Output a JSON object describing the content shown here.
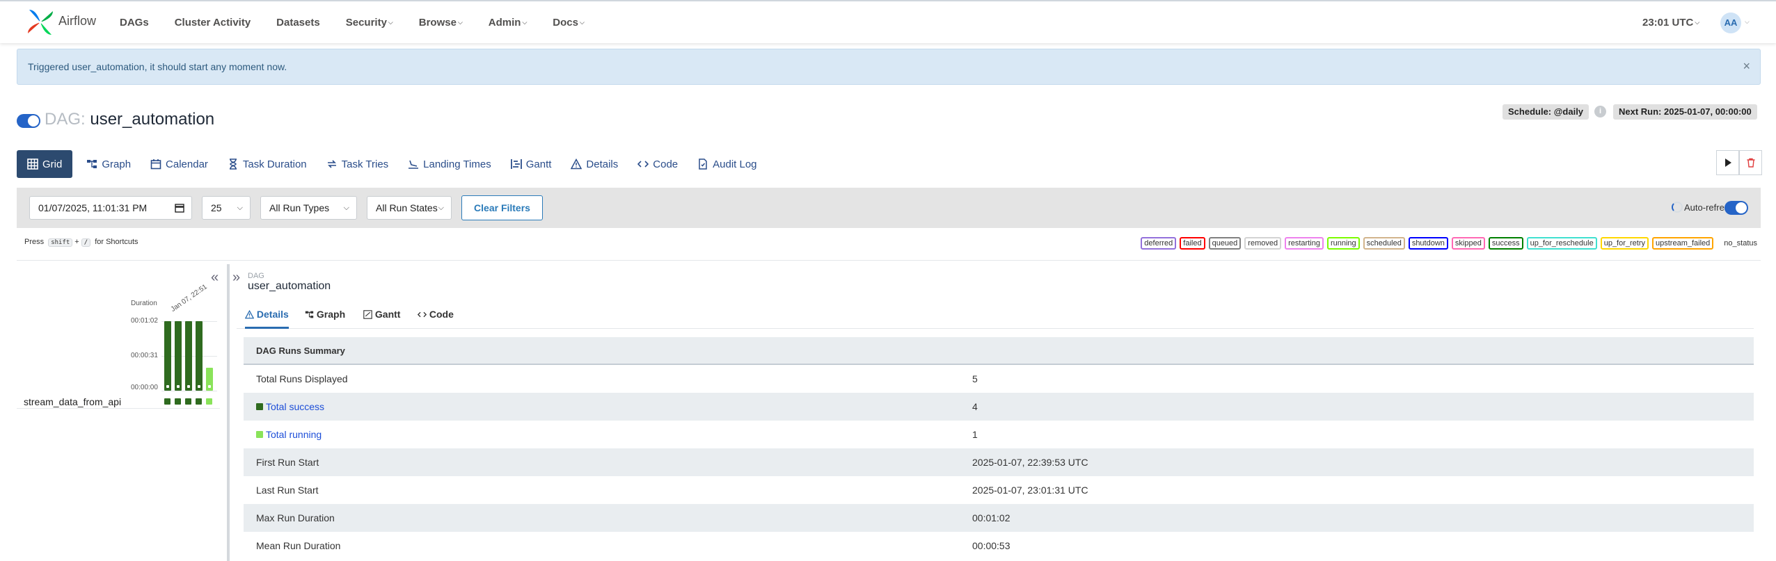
{
  "nav": {
    "brand": "Airflow",
    "links": [
      "DAGs",
      "Cluster Activity",
      "Datasets",
      "Security",
      "Browse",
      "Admin",
      "Docs"
    ],
    "time": "23:01 UTC",
    "avatar": "AA"
  },
  "alert": {
    "message": "Triggered user_automation, it should start any moment now.",
    "close": "×"
  },
  "dag": {
    "prefix": "DAG:",
    "name": "user_automation",
    "paused": false,
    "schedule": "Schedule: @daily",
    "next_run": "Next Run: 2025-01-07, 00:00:00"
  },
  "tabs": [
    "Grid",
    "Graph",
    "Calendar",
    "Task Duration",
    "Task Tries",
    "Landing Times",
    "Gantt",
    "Details",
    "Code",
    "Audit Log"
  ],
  "filters": {
    "date": "01/07/2025, 11:01:31 PM",
    "num_runs": "25",
    "run_type": "All Run Types",
    "run_state": "All Run States",
    "clear": "Clear Filters",
    "auto_refresh": "Auto-refresh"
  },
  "shortcuts": {
    "prefix": "Press",
    "key1": "shift",
    "plus": "+",
    "key2": "/",
    "suffix": "for Shortcuts"
  },
  "legend": [
    {
      "label": "deferred",
      "color": "#9370db"
    },
    {
      "label": "failed",
      "color": "#ff0000"
    },
    {
      "label": "queued",
      "color": "#808080"
    },
    {
      "label": "removed",
      "color": "#d3d3d3"
    },
    {
      "label": "restarting",
      "color": "#ee82ee"
    },
    {
      "label": "running",
      "color": "#7cfc00"
    },
    {
      "label": "scheduled",
      "color": "#d2b48c"
    },
    {
      "label": "shutdown",
      "color": "#0000ff"
    },
    {
      "label": "skipped",
      "color": "#ff69b4"
    },
    {
      "label": "success",
      "color": "#008000"
    },
    {
      "label": "up_for_reschedule",
      "color": "#40e0d0"
    },
    {
      "label": "up_for_retry",
      "color": "#ffd700"
    },
    {
      "label": "upstream_failed",
      "color": "#ffa500"
    },
    {
      "label": "no_status",
      "color": "transparent"
    }
  ],
  "grid": {
    "duration_label": "Duration",
    "ticks": [
      "00:01:02",
      "00:00:31",
      "00:00:00"
    ],
    "date_label": "Jan 07, 22:51",
    "runs": [
      {
        "state": "success",
        "duration_fraction": 1.0
      },
      {
        "state": "success",
        "duration_fraction": 1.0
      },
      {
        "state": "success",
        "duration_fraction": 1.0
      },
      {
        "state": "success",
        "duration_fraction": 1.0
      },
      {
        "state": "running",
        "duration_fraction": 0.33
      }
    ],
    "task": "stream_data_from_api",
    "task_states": [
      "success",
      "success",
      "success",
      "success",
      "running"
    ]
  },
  "details": {
    "crumb_label": "DAG",
    "crumb_name": "user_automation",
    "subtabs": [
      "Details",
      "Graph",
      "Gantt",
      "Code"
    ],
    "summary_title": "DAG Runs Summary",
    "rows": [
      {
        "key": "Total Runs Displayed",
        "value": "5"
      },
      {
        "key": "Total success",
        "value": "4",
        "swatch": "#2f6b1f"
      },
      {
        "key": "Total running",
        "value": "1",
        "swatch": "#8ae35a"
      },
      {
        "key": "First Run Start",
        "value": "2025-01-07, 22:39:53 UTC"
      },
      {
        "key": "Last Run Start",
        "value": "2025-01-07, 23:01:31 UTC"
      },
      {
        "key": "Max Run Duration",
        "value": "00:01:02"
      },
      {
        "key": "Mean Run Duration",
        "value": "00:00:53"
      }
    ]
  }
}
